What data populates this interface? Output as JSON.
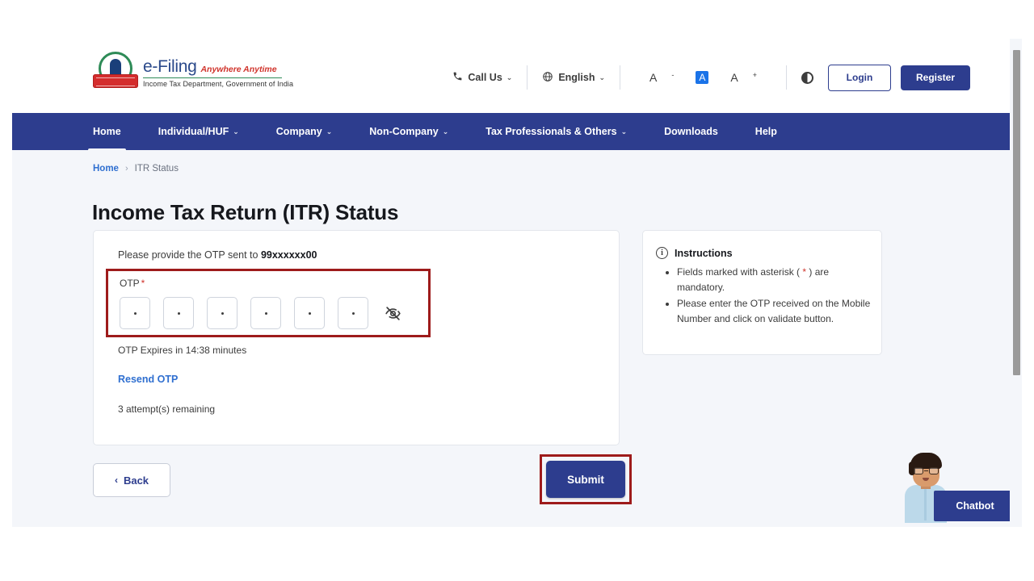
{
  "header": {
    "brand_name": "e-Filing",
    "brand_tagline": "Anywhere Anytime",
    "brand_subtitle": "Income Tax Department, Government of India",
    "emblem_icon": "national-emblem-icon",
    "call_us": "Call Us",
    "call_icon": "phone-icon",
    "language": "English",
    "language_icon": "globe-icon",
    "font_decrease": "A",
    "font_decrease_sup": "-",
    "font_normal": "A",
    "font_increase": "A",
    "font_increase_sup": "+",
    "contrast_icon": "contrast-icon",
    "login_label": "Login",
    "register_label": "Register",
    "caret": "⌄"
  },
  "nav": {
    "items": [
      {
        "label": "Home",
        "has_caret": false,
        "active": true
      },
      {
        "label": "Individual/HUF",
        "has_caret": true,
        "active": false
      },
      {
        "label": "Company",
        "has_caret": true,
        "active": false
      },
      {
        "label": "Non-Company",
        "has_caret": true,
        "active": false
      },
      {
        "label": "Tax Professionals & Others",
        "has_caret": true,
        "active": false
      },
      {
        "label": "Downloads",
        "has_caret": false,
        "active": false
      },
      {
        "label": "Help",
        "has_caret": false,
        "active": false
      }
    ]
  },
  "breadcrumb": {
    "home": "Home",
    "separator": "›",
    "current": "ITR Status"
  },
  "page": {
    "title": "Income Tax Return (ITR) Status"
  },
  "otp_card": {
    "lead_prefix": "Please provide the OTP sent to ",
    "masked_mobile": "99xxxxxx00",
    "field_label": "OTP",
    "required_mark": "*",
    "boxes": [
      "•",
      "•",
      "•",
      "•",
      "•",
      "•"
    ],
    "toggle_visibility_icon": "eye-off-icon",
    "expires_text": "OTP Expires in 14:38 minutes",
    "resend_label": "Resend OTP",
    "attempts_text": "3 attempt(s) remaining"
  },
  "instructions": {
    "icon": "info-icon",
    "title": "Instructions",
    "items": [
      {
        "before": "Fields marked with asterisk ( ",
        "mark": "*",
        "after": " ) are mandatory."
      },
      {
        "before": "Please enter the OTP received on the Mobile Number and click on validate button.",
        "mark": "",
        "after": ""
      }
    ]
  },
  "footer": {
    "back_label": "Back",
    "back_icon": "chevron-left-icon",
    "submit_label": "Submit"
  },
  "chatbot": {
    "label": "Chatbot",
    "avatar_icon": "support-agent-avatar"
  },
  "scrollbar": {
    "name": "vertical-scrollbar"
  },
  "colors": {
    "brand_blue": "#2d3d8e",
    "page_bg": "#f4f6fa",
    "annotation_red": "#9e1b1b",
    "link_blue": "#2f6fd0",
    "required_red": "#d0342c"
  }
}
